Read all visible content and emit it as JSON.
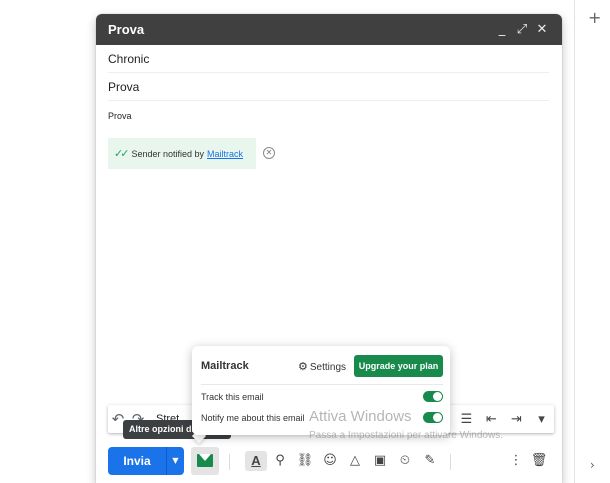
{
  "compose": {
    "title": "Prova",
    "minimize_glyph": "_",
    "fullscreen_glyph": "⤢",
    "close_glyph": "✕",
    "to": "Chronic",
    "subject": "Prova",
    "body": "Prova"
  },
  "notice": {
    "ticks": "✓✓",
    "text": "Sender notified by",
    "link": "Mailtrack",
    "close_glyph": "✕"
  },
  "format_bar": {
    "undo_glyph": "↶",
    "redo_glyph": "↷",
    "font_label": "Stret",
    "list_glyph": "☰",
    "indent_less_glyph": "⇤",
    "indent_more_glyph": "⇥",
    "more_glyph": "▾"
  },
  "tooltip": "Altre opzioni di invio",
  "popup": {
    "brand": "Mailtrack",
    "settings_glyph": "⚙",
    "settings_label": "Settings",
    "upgrade_label": "Upgrade your plan",
    "rows": [
      {
        "label": "Track this email",
        "on": true
      },
      {
        "label": "Notify me about this email",
        "on": true
      }
    ],
    "accent": "#178a4c"
  },
  "watermark": {
    "title": "Attiva Windows",
    "subtitle": "Passa a Impostazioni per attivare Windows."
  },
  "actions": {
    "send_label": "Invia",
    "send_more_glyph": "▼",
    "format_glyph": "A",
    "attach_glyph": "⚲",
    "link_glyph": "⛓",
    "emoji_glyph": "☺",
    "drive_glyph": "△",
    "photo_glyph": "▣",
    "confidential_glyph": "⏲",
    "signature_glyph": "✎",
    "more_glyph": "⋮",
    "delete_glyph": "🗑",
    "send_color": "#1a73e8"
  },
  "rail": {
    "add_glyph": "+",
    "expand_glyph": "›"
  }
}
